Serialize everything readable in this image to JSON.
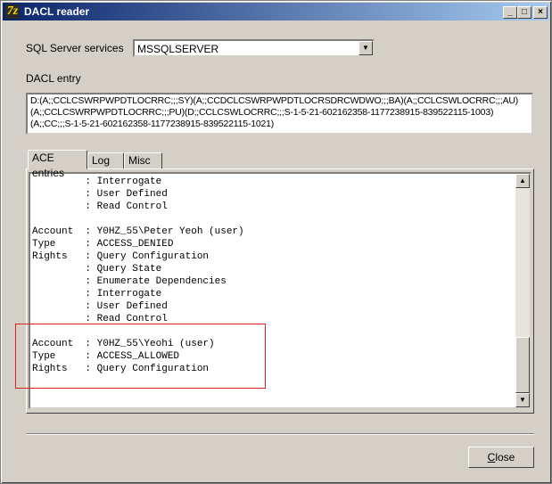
{
  "window": {
    "title": "DACL reader",
    "icon_glyph": "7z",
    "controls": {
      "minimize": "_",
      "maximize": "□",
      "close": "×"
    }
  },
  "services": {
    "label": "SQL Server services",
    "selected": "MSSQLSERVER"
  },
  "dacl": {
    "label": "DACL entry",
    "value": "D:(A;;CCLCSWRPWPDTLOCRRC;;;SY)(A;;CCDCLCSWRPWPDTLOCRSDRCWDWO;;;BA)(A;;CCLCSWLOCRRC;;;AU)(A;;CCLCSWRPWPDTLOCRRC;;;PU)(D;;CCLCSWLOCRRC;;;S-1-5-21-602162358-1177238915-839522115-1003)(A;;CC;;;S-1-5-21-602162358-1177238915-839522115-1021)"
  },
  "tabs": [
    {
      "label": "ACE entries",
      "active": true
    },
    {
      "label": "Log",
      "active": false
    },
    {
      "label": "Misc",
      "active": false
    }
  ],
  "ace_lines": [
    "         : Interrogate",
    "         : User Defined",
    "         : Read Control",
    "",
    "Account  : Y0HZ_55\\Peter Yeoh (user)",
    "Type     : ACCESS_DENIED",
    "Rights   : Query Configuration",
    "         : Query State",
    "         : Enumerate Dependencies",
    "         : Interrogate",
    "         : User Defined",
    "         : Read Control",
    "",
    "Account  : Y0HZ_55\\Yeohi (user)",
    "Type     : ACCESS_ALLOWED",
    "Rights   : Query Configuration"
  ],
  "scrollbar": {
    "up_glyph": "▲",
    "down_glyph": "▼"
  },
  "combo_glyph": "▼",
  "close_button": {
    "label_first": "C",
    "label_rest": "lose"
  },
  "colors": {
    "title_start": "#0a246a",
    "title_end": "#a6caf0",
    "highlight": "#e02020",
    "face": "#d4d0c8"
  }
}
